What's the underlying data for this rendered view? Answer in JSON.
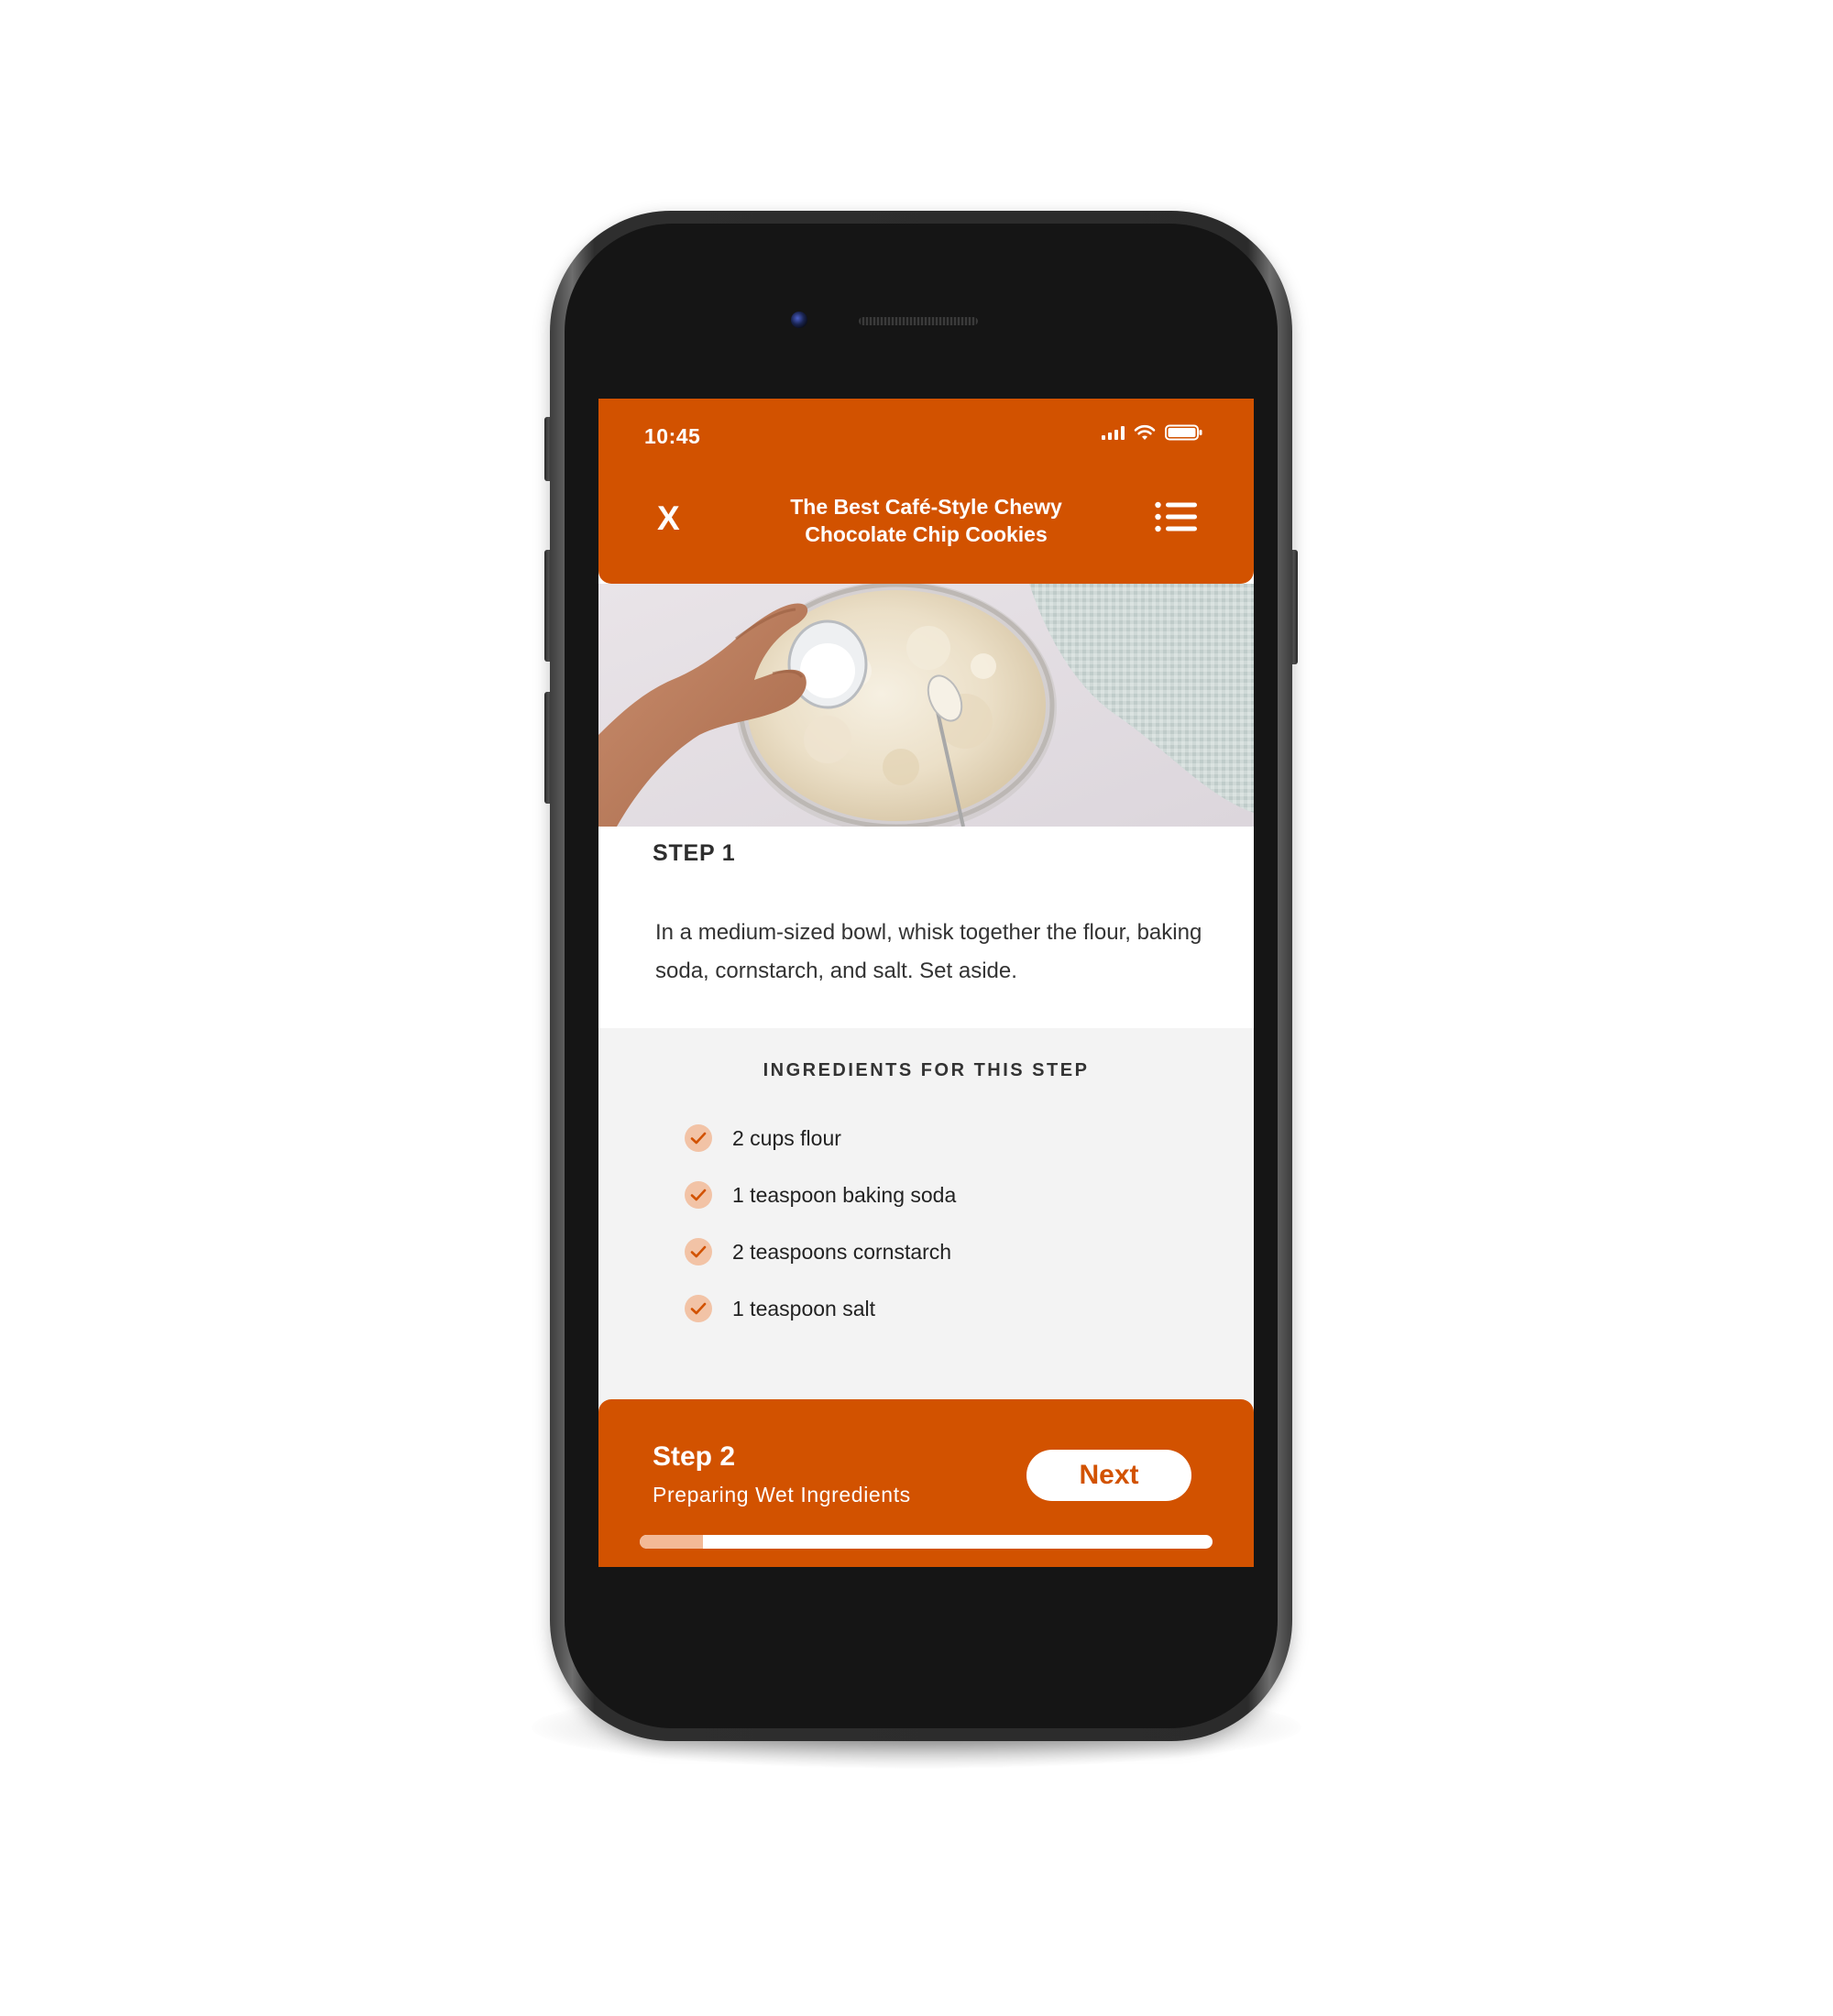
{
  "status_bar": {
    "time": "10:45"
  },
  "header": {
    "close_label": "X",
    "title": "The Best Café-Style Chewy Chocolate Chip Cookies",
    "menu_icon": "list-icon"
  },
  "current_step": {
    "label": "STEP 1",
    "instruction": "In a medium-sized bowl, whisk together the flour, baking soda, cornstarch, and salt. Set aside."
  },
  "ingredients": {
    "heading": "INGREDIENTS FOR THIS STEP",
    "items": [
      {
        "text": "2 cups flour",
        "checked": true
      },
      {
        "text": "1 teaspoon baking soda",
        "checked": true
      },
      {
        "text": "2 teaspoons cornstarch",
        "checked": true
      },
      {
        "text": "1 teaspoon salt",
        "checked": true
      }
    ]
  },
  "next_step": {
    "title": "Step 2",
    "subtitle": "Preparing Wet Ingredients",
    "button_label": "Next"
  },
  "progress": {
    "fraction": 0.11
  },
  "colors": {
    "accent": "#d25200",
    "check_bg": "#f2c3a6",
    "progress_fill": "#f3b996",
    "panel_bg": "#f3f3f3"
  }
}
